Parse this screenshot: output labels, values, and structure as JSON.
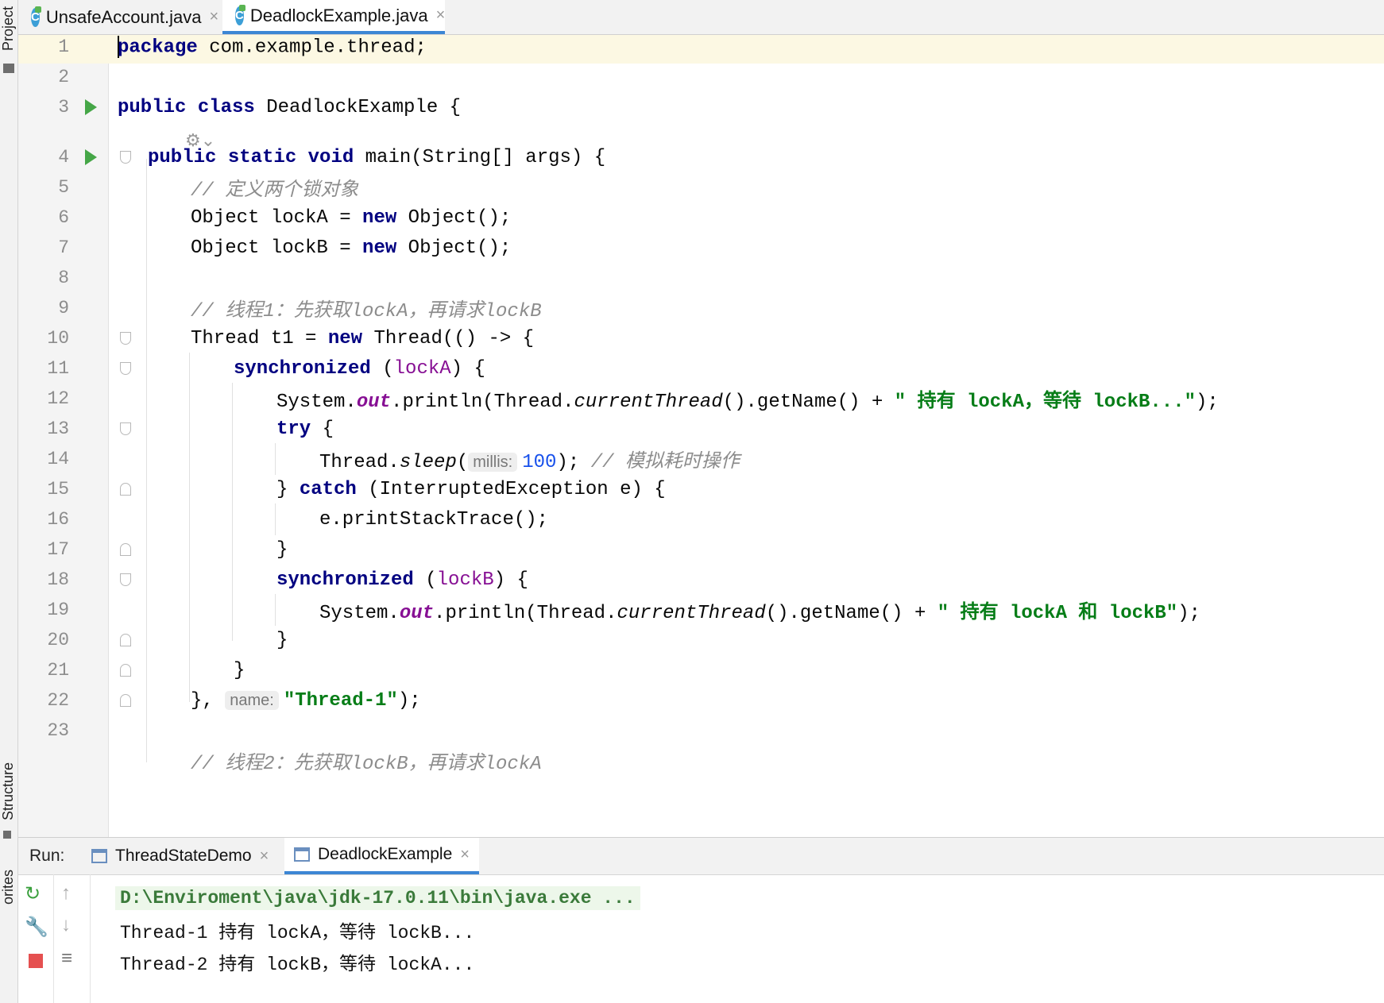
{
  "side_labels": {
    "project": "Project",
    "structure": "Structure",
    "favorites": "orites"
  },
  "tabs": [
    {
      "label": "UnsafeAccount.java",
      "active": false
    },
    {
      "label": "DeadlockExample.java",
      "active": true
    }
  ],
  "code": {
    "line_numbers": [
      "1",
      "2",
      "3",
      "4",
      "5",
      "6",
      "7",
      "8",
      "9",
      "10",
      "11",
      "12",
      "13",
      "14",
      "15",
      "16",
      "17",
      "18",
      "19",
      "20",
      "21",
      "22",
      "23"
    ],
    "l1": {
      "kw": "package",
      "rest": " com.example.thread;"
    },
    "l3": {
      "kw": "public class",
      "rest": " DeadlockExample {"
    },
    "l4": {
      "kw": "public static void",
      "rest": " main(String[] args) {"
    },
    "l5": {
      "comment": "// 定义两个锁对象"
    },
    "l6": {
      "a": "Object lockA = ",
      "kw": "new",
      "b": " Object();"
    },
    "l7": {
      "a": "Object lockB = ",
      "kw": "new",
      "b": " Object();"
    },
    "l9": {
      "comment": "// 线程1：先获取lockA，再请求lockB"
    },
    "l10": {
      "a": "Thread t1 = ",
      "kw": "new",
      "b": " Thread(() -> {"
    },
    "l11": {
      "kw": "synchronized",
      "a": " (",
      "var": "lockA",
      "b": ") {"
    },
    "l12": {
      "a": "System.",
      "field": "out",
      "b": ".println(Thread.",
      "method": "currentThread",
      "c": "().getName() + ",
      "str": "\" 持有 lockA，等待 lockB...\"",
      "d": ");"
    },
    "l13": {
      "kw": "try",
      "a": " {"
    },
    "l14": {
      "a": "Thread.",
      "method": "sleep",
      "b": "(",
      "hint": "millis:",
      "num": "100",
      "c": "); ",
      "comment": "// 模拟耗时操作"
    },
    "l15": {
      "a": "} ",
      "kw": "catch",
      "b": " (InterruptedException e) {"
    },
    "l16": {
      "a": "e.printStackTrace();"
    },
    "l17": {
      "a": "}"
    },
    "l18": {
      "kw": "synchronized",
      "a": " (",
      "var": "lockB",
      "b": ") {"
    },
    "l19": {
      "a": "System.",
      "field": "out",
      "b": ".println(Thread.",
      "method": "currentThread",
      "c": "().getName() + ",
      "str": "\" 持有 lockA 和 lockB\"",
      "d": ");"
    },
    "l20": {
      "a": "}"
    },
    "l21": {
      "a": "}"
    },
    "l22": {
      "a": "}, ",
      "hint": "name:",
      "str": "\"Thread-1\"",
      "b": ");"
    },
    "l24_partial": "// 线程2：先获取lockB，再请求lockA"
  },
  "run": {
    "label": "Run:",
    "tabs": [
      {
        "label": "ThreadStateDemo",
        "active": false
      },
      {
        "label": "DeadlockExample",
        "active": true
      }
    ],
    "console": [
      "D:\\Enviroment\\java\\jdk-17.0.11\\bin\\java.exe ...",
      "Thread-1 持有 lockA，等待 lockB...",
      "Thread-2 持有 lockB，等待 lockA..."
    ]
  }
}
